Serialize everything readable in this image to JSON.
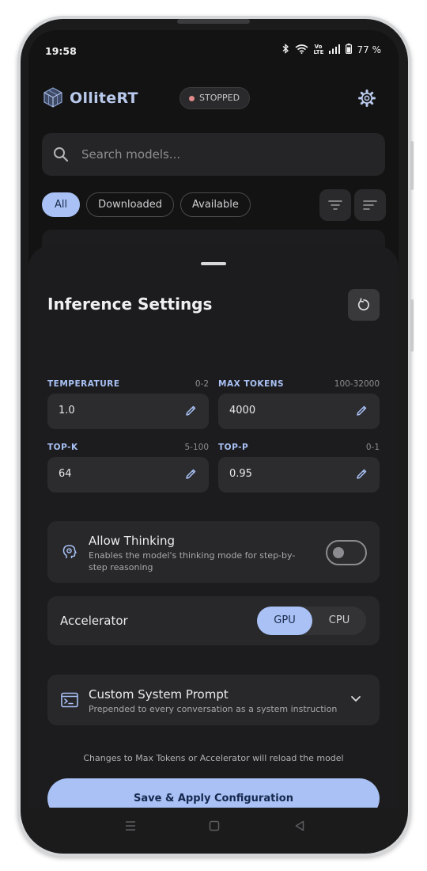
{
  "status_bar": {
    "time": "19:58",
    "bluetooth_icon": "bluetooth-icon",
    "wifi_icon": "wifi-icon",
    "volte": "Vo LTE",
    "signal_icon": "signal-icon",
    "battery_icon": "battery-icon",
    "battery": "77 %"
  },
  "appbar": {
    "title": "OlliteRT",
    "status": "STOPPED",
    "status_color": "#e08a8a",
    "settings_icon": "gear-icon"
  },
  "search": {
    "placeholder": "Search models..."
  },
  "filters": {
    "chips": [
      "All",
      "Downloaded",
      "Available"
    ],
    "active": "All"
  },
  "sheet": {
    "title": "Inference Settings",
    "reset_icon": "reset-icon",
    "params": {
      "temperature": {
        "label": "TEMPERATURE",
        "range": "0-2",
        "value": "1.0"
      },
      "max_tokens": {
        "label": "MAX TOKENS",
        "range": "100-32000",
        "value": "4000"
      },
      "top_k": {
        "label": "TOP-K",
        "range": "5-100",
        "value": "64"
      },
      "top_p": {
        "label": "TOP-P",
        "range": "0-1",
        "value": "0.95"
      }
    },
    "thinking": {
      "title": "Allow Thinking",
      "description": "Enables the model's thinking mode for step-by-step reasoning",
      "enabled": false
    },
    "accelerator": {
      "label": "Accelerator",
      "options": [
        "GPU",
        "CPU"
      ],
      "selected": "GPU"
    },
    "system_prompt": {
      "title": "Custom System Prompt",
      "description": "Prepended to every conversation as a system instruction"
    },
    "note": "Changes to Max Tokens or Accelerator will reload the model",
    "save_label": "Save & Apply Configuration"
  },
  "colors": {
    "accent": "#a9c1f5",
    "background": "#131313",
    "sheet": "#1c1c1e"
  }
}
